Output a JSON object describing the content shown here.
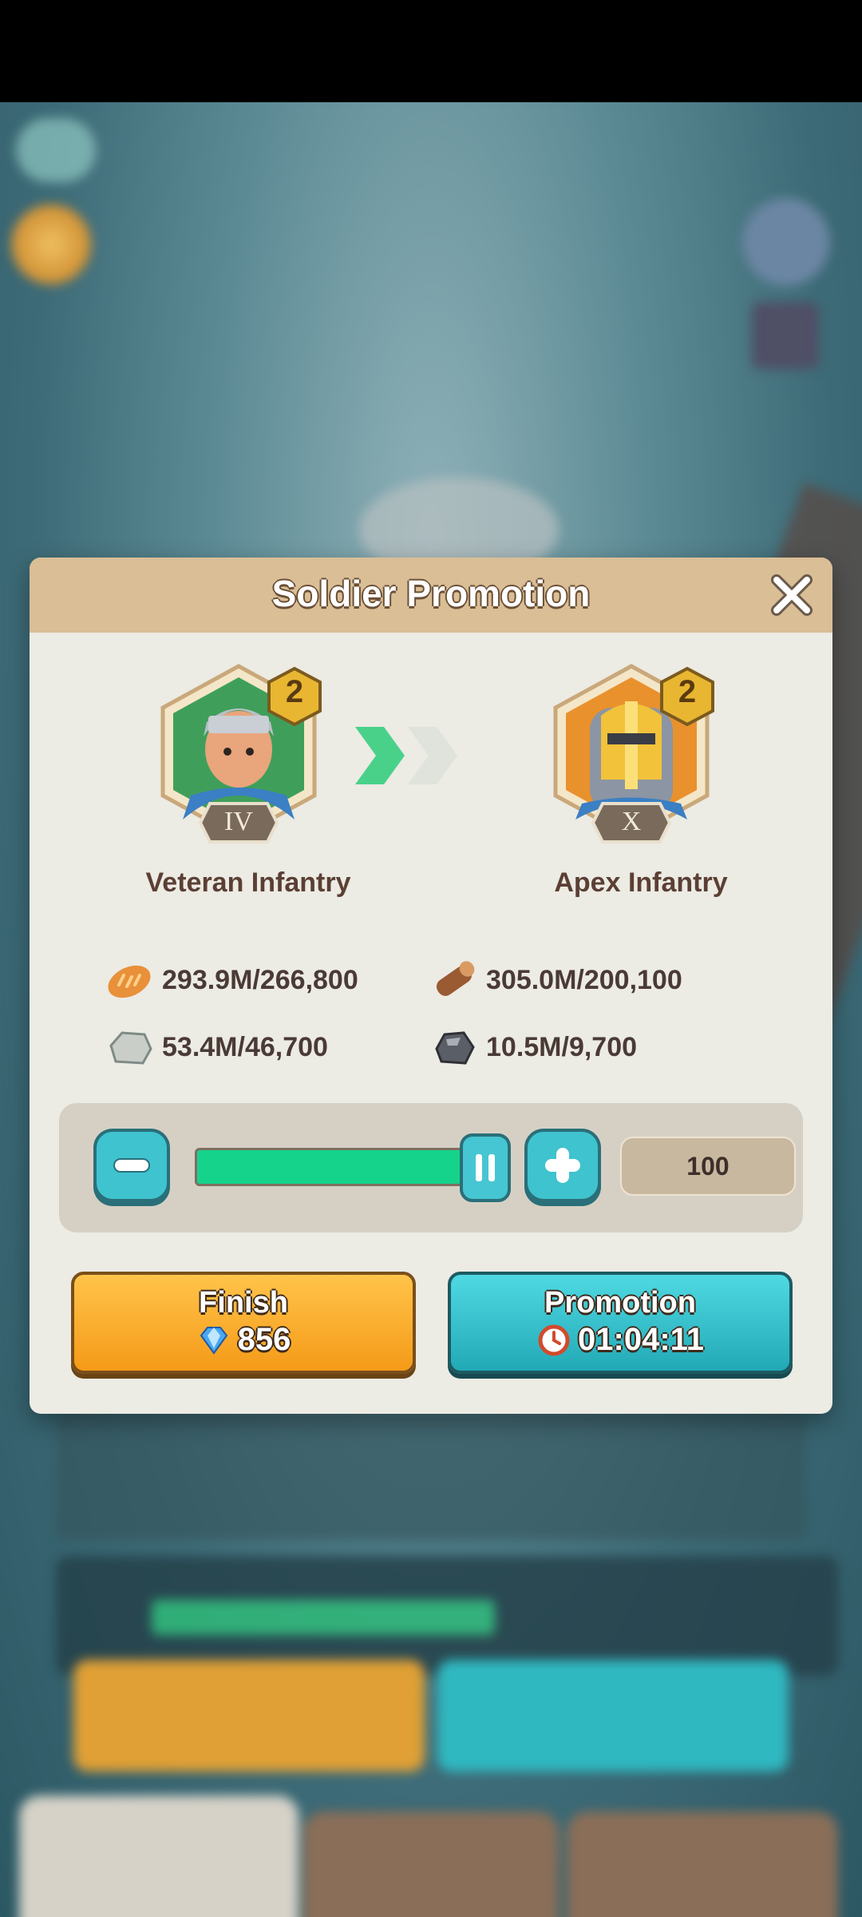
{
  "dialog": {
    "title": "Soldier Promotion"
  },
  "units": {
    "from": {
      "name": "Veteran Infantry",
      "tier": "IV",
      "level": "2"
    },
    "to": {
      "name": "Apex Infantry",
      "tier": "X",
      "level": "2"
    }
  },
  "resources": [
    {
      "icon": "bread-icon",
      "text": "293.9M/266,800"
    },
    {
      "icon": "wood-log-icon",
      "text": "305.0M/200,100"
    },
    {
      "icon": "stone-icon",
      "text": "53.4M/46,700"
    },
    {
      "icon": "iron-ore-icon",
      "text": "10.5M/9,700"
    }
  ],
  "slider": {
    "quantity": "100",
    "fill_fraction": 1.0
  },
  "buttons": {
    "finish_label": "Finish",
    "finish_cost": "856",
    "promotion_label": "Promotion",
    "promotion_time": "01:04:11"
  },
  "colors": {
    "header": "#d9be96",
    "panel": "#ecebe4",
    "finish": "#f59a18",
    "promotion": "#22a9b6",
    "slider_fill": "#16d38c"
  }
}
